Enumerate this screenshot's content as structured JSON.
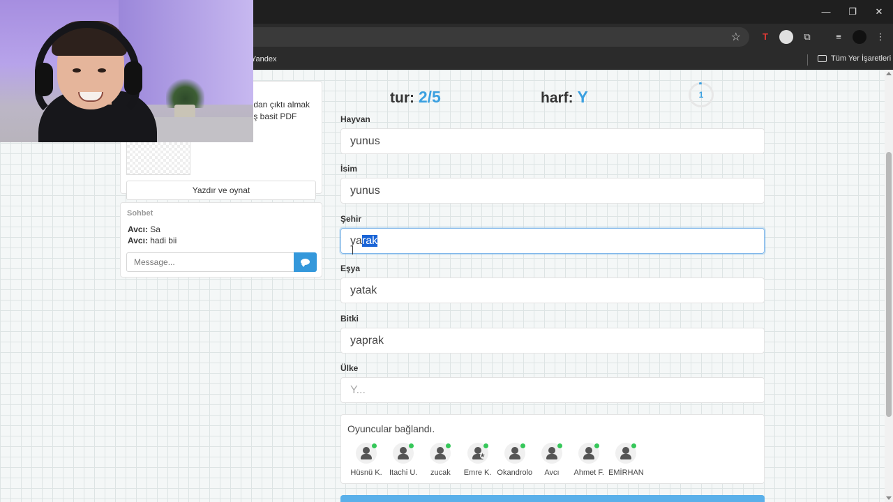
{
  "browser": {
    "window_controls": {
      "minimize": "—",
      "restore": "❐",
      "close": "✕"
    },
    "bookmark_left_label": "Yandex",
    "bookmark_right_label": "Tüm Yer İşaretleri"
  },
  "sidebar": {
    "snippet_lines": [
      "ıdan çıktı almak",
      "ış basit PDF"
    ],
    "print_button_label": "Yazdır ve oynat"
  },
  "chat": {
    "title": "Sohbet",
    "messages": [
      {
        "author": "Avcı:",
        "text": "Sa"
      },
      {
        "author": "Avcı:",
        "text": "hadi bii"
      }
    ],
    "input_placeholder": "Message...",
    "send_icon": "comment-icon"
  },
  "game": {
    "round_label": "tur:",
    "round_value": "2/5",
    "letter_label": "harf:",
    "letter_value": "Y",
    "timer_value": "1",
    "accent_color": "#3ba0e0"
  },
  "fields": [
    {
      "label": "Hayvan",
      "value": "yunus"
    },
    {
      "label": "İsim",
      "value": "yunus"
    },
    {
      "label": "Şehir",
      "value_plain": "ya",
      "value_selected": "rak"
    },
    {
      "label": "Eşya",
      "value": "yatak"
    },
    {
      "label": "Bitki",
      "value": "yaprak"
    },
    {
      "label": "Ülke",
      "placeholder": "Y..."
    }
  ],
  "players": {
    "status": "Oyuncular bağlandı.",
    "list": [
      "Hüsnü K.",
      "Itachi U.",
      "zucak",
      "Emre K.",
      "Okandrolo",
      "Avcı",
      "Ahmet F.",
      "EMİRHAN"
    ],
    "online_color": "#35c759"
  }
}
